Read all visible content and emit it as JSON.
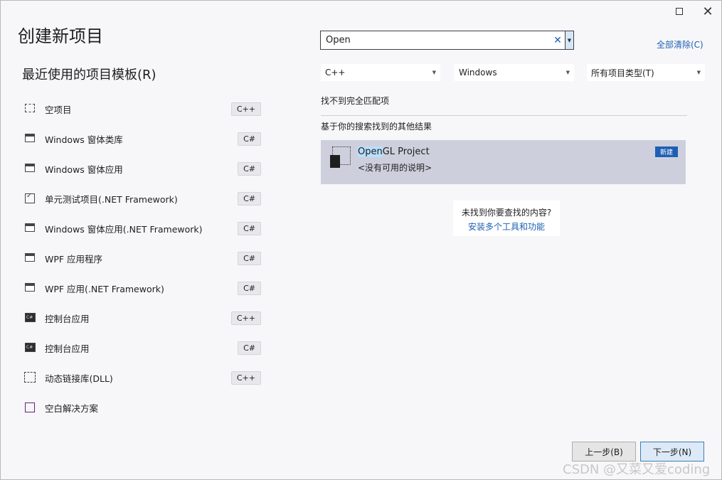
{
  "window": {
    "maximize_symbol": "☐",
    "close_symbol": "✕"
  },
  "page_title": "创建新项目",
  "recent": {
    "title": "最近使用的项目模板(R)",
    "templates": [
      {
        "label": "空项目",
        "lang": "C++",
        "icon": "empty-project-icon"
      },
      {
        "label": "Windows 窗体类库",
        "lang": "C#",
        "icon": "winforms-library-icon"
      },
      {
        "label": "Windows 窗体应用",
        "lang": "C#",
        "icon": "winforms-app-icon"
      },
      {
        "label": "单元测试项目(.NET Framework)",
        "lang": "C#",
        "icon": "unit-test-icon"
      },
      {
        "label": "Windows 窗体应用(.NET Framework)",
        "lang": "C#",
        "icon": "winforms-app-icon"
      },
      {
        "label": "WPF 应用程序",
        "lang": "C#",
        "icon": "wpf-app-icon"
      },
      {
        "label": "WPF 应用(.NET Framework)",
        "lang": "C#",
        "icon": "wpf-app-icon"
      },
      {
        "label": "控制台应用",
        "lang": "C++",
        "icon": "console-app-icon"
      },
      {
        "label": "控制台应用",
        "lang": "C#",
        "icon": "console-app-icon"
      },
      {
        "label": "动态链接库(DLL)",
        "lang": "C++",
        "icon": "dll-icon"
      },
      {
        "label": "空白解决方案",
        "lang": "",
        "icon": "blank-solution-icon"
      }
    ]
  },
  "search": {
    "value": "Open",
    "clear_symbol": "✕",
    "drop_symbol": "▼"
  },
  "clear_all_label": "全部清除(C)",
  "filters": {
    "language": "C++",
    "platform": "Windows",
    "project_type": "所有项目类型(T)",
    "caret": "▼"
  },
  "results": {
    "no_exact_match": "找不到完全匹配项",
    "other_results_header": "基于你的搜索找到的其他结果",
    "items": [
      {
        "title_highlight": "Open",
        "title_rest": "GL Project",
        "desc": "<没有可用的说明>",
        "badge": "新建"
      }
    ]
  },
  "not_found": {
    "question": "未找到你要查找的内容?",
    "link": "安装多个工具和功能"
  },
  "buttons": {
    "back": "上一步(B)",
    "next": "下一步(N)"
  },
  "watermark": "CSDN @又菜又爱coding",
  "colors": {
    "accent": "#1e5fb4",
    "selected_row": "#cdd0dc"
  }
}
